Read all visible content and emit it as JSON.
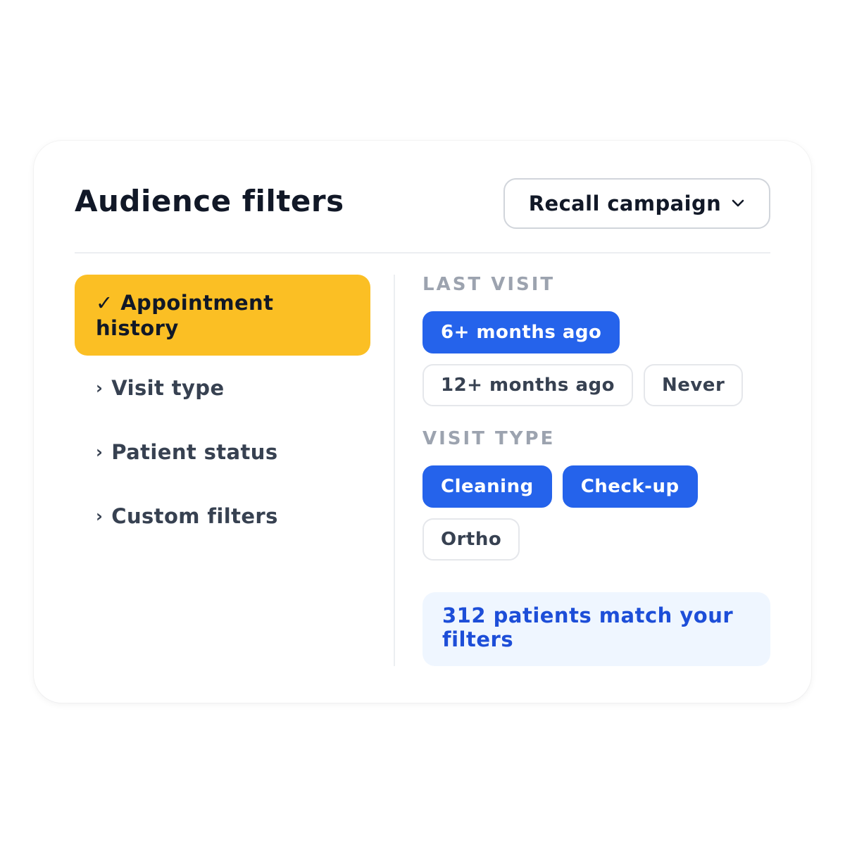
{
  "header": {
    "title": "Audience filters",
    "campaign_select": {
      "selected": "Recall campaign",
      "icon": "chevron-down-icon"
    }
  },
  "sidebar": {
    "active_item": {
      "check_glyph": "✓",
      "label": "Appointment history"
    },
    "items": [
      {
        "label": "Visit type",
        "icon": "chevron-right-icon"
      },
      {
        "label": "Patient status",
        "icon": "chevron-right-icon"
      },
      {
        "label": "Custom filters",
        "icon": "chevron-right-icon"
      }
    ]
  },
  "filters": {
    "last_visit": {
      "label": "LAST VISIT",
      "options": [
        {
          "label": "6+ months ago",
          "selected": true
        },
        {
          "label": "12+ months ago",
          "selected": false
        },
        {
          "label": "Never",
          "selected": false
        }
      ]
    },
    "visit_type": {
      "label": "VISIT TYPE",
      "options": [
        {
          "label": "Cleaning",
          "selected": true
        },
        {
          "label": "Check-up",
          "selected": true
        },
        {
          "label": "Ortho",
          "selected": false
        }
      ]
    }
  },
  "result": {
    "text": "312 patients match your filters"
  },
  "colors": {
    "accent": "#2563eb",
    "active_nav": "#fbbf24",
    "result_bg": "#eff6ff",
    "result_text": "#1d4ed8"
  }
}
